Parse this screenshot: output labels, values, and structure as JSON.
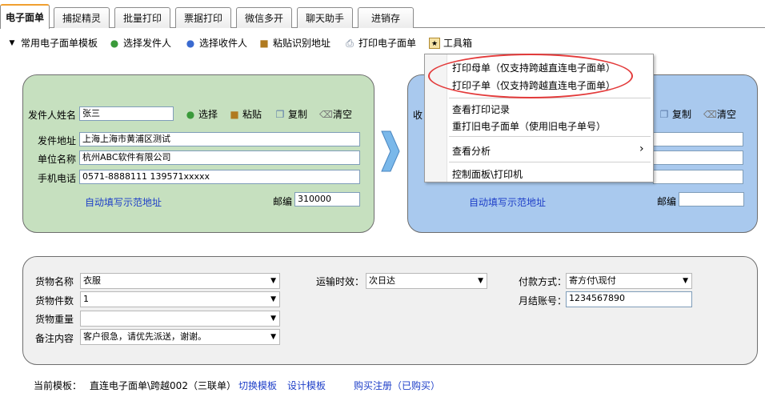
{
  "tabs": [
    "电子面单",
    "捕捉精灵",
    "批量打印",
    "票据打印",
    "微信多开",
    "聊天助手",
    "进销存"
  ],
  "toolbar": {
    "template_menu": "常用电子面单模板",
    "select_sender": "选择发件人",
    "select_receiver": "选择收件人",
    "paste_address": "粘贴识别地址",
    "print_waybill": "打印电子面单",
    "toolbox": "工具箱"
  },
  "sender": {
    "name_label": "发件人姓名",
    "name_value": "张三",
    "select": "选择",
    "paste": "粘贴",
    "copy": "复制",
    "clear": "清空",
    "address_label": "发件地址",
    "address_value": "上海上海市黄浦区测试",
    "company_label": "单位名称",
    "company_value": "杭州ABC软件有限公司",
    "phone_label": "手机电话",
    "phone_value": "0571-8888111 139571xxxxx",
    "autofill_link": "自动填写示范地址",
    "zip_label": "邮编",
    "zip_value": "310000"
  },
  "receiver": {
    "name_label_partial": "收",
    "copy": "复制",
    "clear": "清空",
    "autofill_link": "自动填写示范地址",
    "zip_label": "邮编",
    "zip_value": ""
  },
  "menu": {
    "items": [
      "打印母单（仅支持跨越直连电子面单）",
      "打印子单（仅支持跨越直连电子面单）",
      "查看打印记录",
      "重打旧电子面单（使用旧电子单号）",
      "查看分析",
      "控制面板\\打印机"
    ],
    "submenu_arrow": "›"
  },
  "goods": {
    "name_label": "货物名称",
    "name_value": "衣服",
    "count_label": "货物件数",
    "count_value": "1",
    "weight_label": "货物重量",
    "weight_value": "",
    "remark_label": "备注内容",
    "remark_value": "客户很急，请优先派送，谢谢。",
    "transit_label": "运输时效：",
    "transit_value": "次日达",
    "payment_label": "付款方式：",
    "payment_value": "寄方付\\现付",
    "account_label": "月结账号：",
    "account_value": "1234567890"
  },
  "footer": {
    "current_template_label": "当前模板：",
    "current_template_value": "直连电子面单\\跨越002（三联单）",
    "switch_template": "切换模板",
    "design_template": "设计模板",
    "purchase": "购买注册（已购买）"
  },
  "colors": {
    "sender_panel": "#c6e0bf",
    "receiver_panel": "#a9c9ee",
    "goods_panel": "#f0f0f0",
    "link": "#1e3fc8",
    "highlight": "#e33b3b"
  }
}
